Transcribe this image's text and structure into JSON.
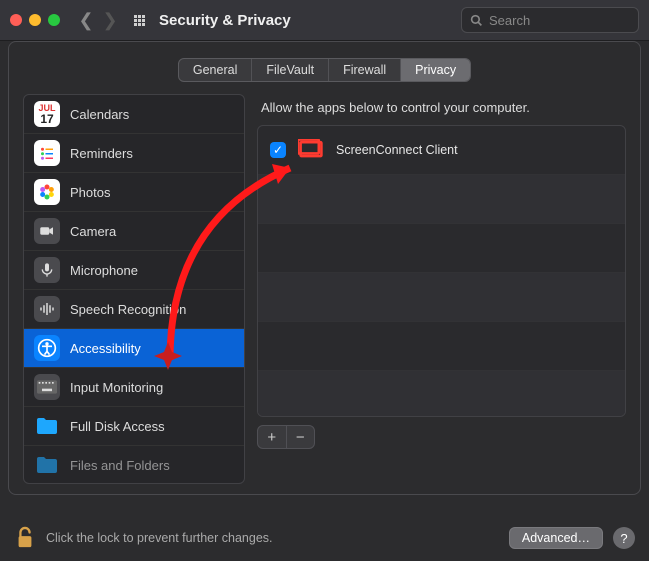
{
  "colors": {
    "close": "#ff5f57",
    "min": "#febc2e",
    "max": "#28c840",
    "accent": "#0a63d6"
  },
  "window": {
    "title": "Security & Privacy"
  },
  "search": {
    "placeholder": "Search"
  },
  "tabs": [
    {
      "label": "General"
    },
    {
      "label": "FileVault"
    },
    {
      "label": "Firewall"
    },
    {
      "label": "Privacy",
      "active": true
    }
  ],
  "sidebar": [
    {
      "key": "calendars",
      "label": "Calendars"
    },
    {
      "key": "reminders",
      "label": "Reminders"
    },
    {
      "key": "photos",
      "label": "Photos"
    },
    {
      "key": "camera",
      "label": "Camera"
    },
    {
      "key": "microphone",
      "label": "Microphone"
    },
    {
      "key": "speech",
      "label": "Speech Recognition"
    },
    {
      "key": "accessibility",
      "label": "Accessibility",
      "selected": true
    },
    {
      "key": "input-monitoring",
      "label": "Input Monitoring"
    },
    {
      "key": "full-disk",
      "label": "Full Disk Access"
    },
    {
      "key": "files-folders",
      "label": "Files and Folders"
    }
  ],
  "right": {
    "heading": "Allow the apps below to control your computer.",
    "apps": [
      {
        "name": "ScreenConnect Client",
        "checked": true
      }
    ]
  },
  "footer": {
    "lock_text": "Click the lock to prevent further changes.",
    "advanced": "Advanced…",
    "help": "?"
  }
}
